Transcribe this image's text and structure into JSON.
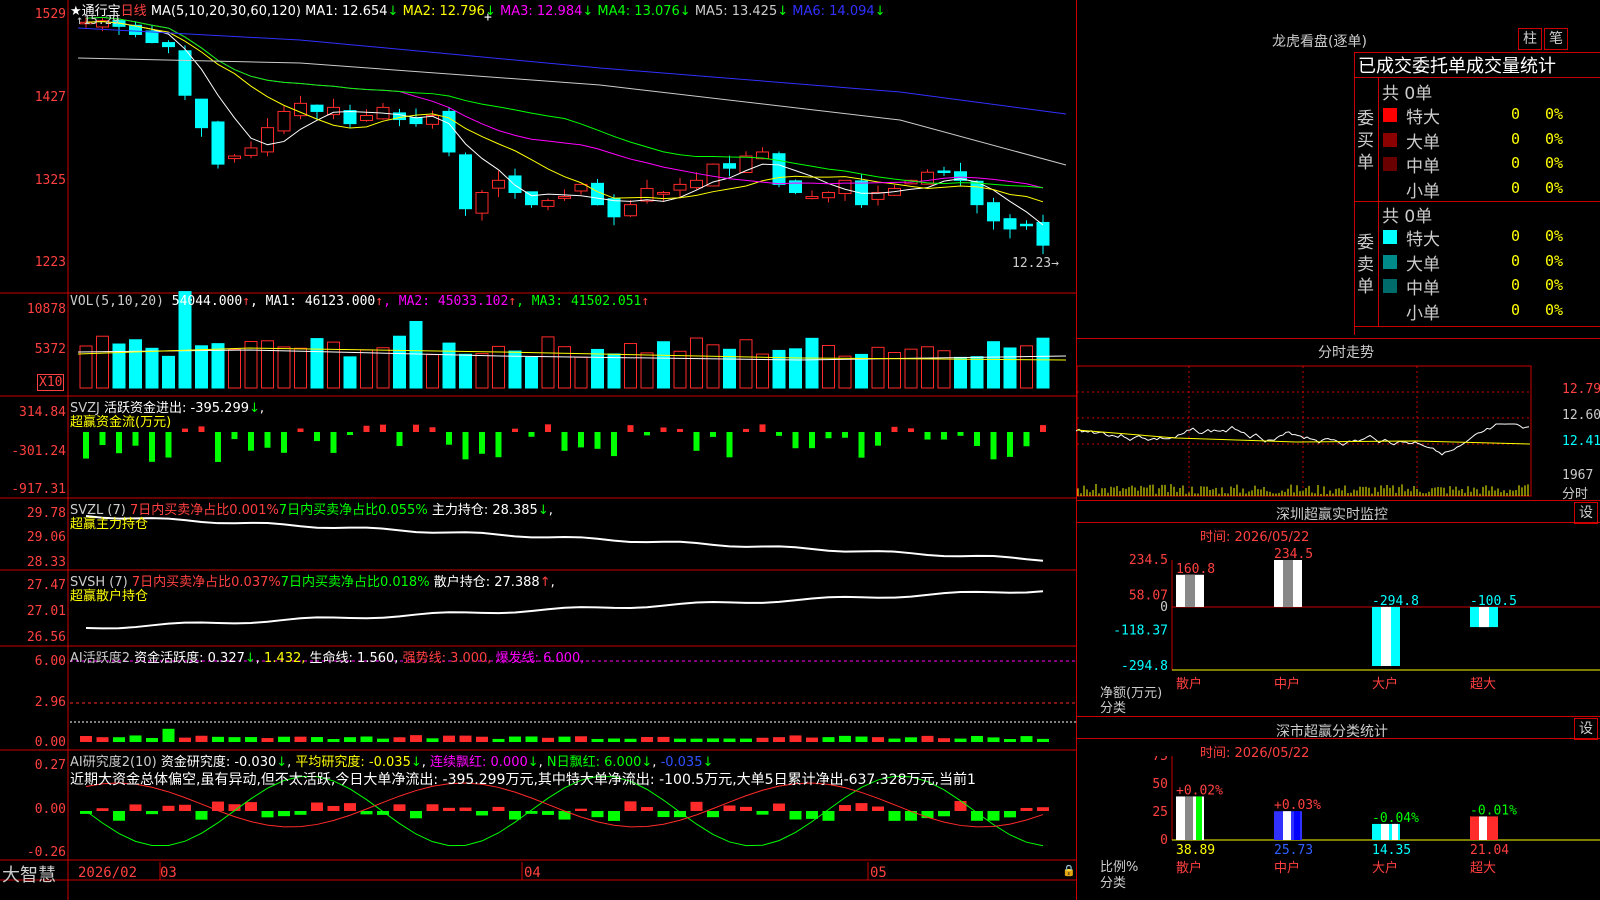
{
  "main": {
    "stock_name": "通行宝",
    "period": "日线",
    "high_label": "15.29",
    "last_label": "12.23",
    "ma_title": "MA(5,10,20,30,60,120)",
    "ma": [
      {
        "name": "MA1",
        "value": "12.654",
        "color": "#ffffff"
      },
      {
        "name": "MA2",
        "value": "12.796",
        "color": "#ffff00"
      },
      {
        "name": "MA3",
        "value": "12.984",
        "color": "#ff00ff"
      },
      {
        "name": "MA4",
        "value": "13.076",
        "color": "#00ff00"
      },
      {
        "name": "MA5",
        "value": "13.425",
        "color": "#cccccc"
      },
      {
        "name": "MA6",
        "value": "14.094",
        "color": "#3030ff"
      }
    ],
    "y_ticks": [
      "1529",
      "1427",
      "1325",
      "1223"
    ],
    "arrow_down": "↓"
  },
  "vol": {
    "title": "VOL(5,10,20)",
    "value": "54044.000",
    "ma": [
      {
        "name": "MA1",
        "value": "46123.000",
        "color": "#ffffff"
      },
      {
        "name": "MA2",
        "value": "45033.102",
        "color": "#ff00ff"
      },
      {
        "name": "MA3",
        "value": "41502.051",
        "color": "#00ff00"
      }
    ],
    "y_ticks": [
      "10878",
      "5372"
    ],
    "unit": "X10",
    "arrow_up": "↑"
  },
  "svzj": {
    "title": "SVZJ",
    "text": "活跃资金进出: -395.299",
    "sub": "超赢资金流(万元)",
    "y_ticks": [
      "314.84",
      "-301.24",
      "-917.31"
    ]
  },
  "svzl": {
    "title": "SVZL (7)",
    "t1": "7日内买卖净占比0.001%",
    "t2": "7日内买卖净占比0.055%",
    "t3": "主力持仓: 28.385",
    "sub": "超赢主力持仓",
    "y_ticks": [
      "29.78",
      "29.06",
      "28.33"
    ]
  },
  "svsh": {
    "title": "SVSH (7)",
    "t1": "7日内买卖净占比0.037%",
    "t2": "7日内买卖净占比0.018%",
    "t3": "散户持仓: 27.388",
    "sub": "超赢散户持仓",
    "y_ticks": [
      "27.47",
      "27.01",
      "26.56"
    ]
  },
  "ai1": {
    "title": "AI活跃度2",
    "t1": "资金活跃度: 0.327",
    "t2": "1.432,",
    "t3": "生命线: 1.560,",
    "t4": "强势线: 3.000,",
    "t5": "爆发线: 6.000,",
    "y_ticks": [
      "6.00",
      "2.96",
      "0.00"
    ]
  },
  "ai2": {
    "title": "AI研究度2(10)",
    "t1": "资金研究度: -0.030",
    "t2": "平均研究度: -0.035",
    "t3": "连续飘红: 0.000",
    "t4": "N日飘红: 6.000",
    "t5": "-0.035",
    "note": "近期大资金总体偏空,虽有异动,但不太活跃,今日大单净流出: -395.299万元,其中特大单净流出: -100.5万元,大单5日累计净出-637.328万元,当前1",
    "y_ticks": [
      "0.27",
      "0.00",
      "-0.26"
    ]
  },
  "bottom": {
    "brand": "大智慧",
    "dates": [
      "2026/02",
      "03",
      "04",
      "05"
    ]
  },
  "right": {
    "lhkp_title": "龙虎看盘(逐单)",
    "btn_zhu": "柱",
    "btn_bi": "笔",
    "stats_title": "已成交委托单成交量统计",
    "buy": {
      "side": "委买单",
      "total": "共 0单",
      "rows": [
        {
          "label": "特大",
          "count": "0",
          "pct": "0%",
          "color": "#ff0000"
        },
        {
          "label": "大单",
          "count": "0",
          "pct": "0%",
          "color": "#8b0000"
        },
        {
          "label": "中单",
          "count": "0",
          "pct": "0%",
          "color": "#6b0000"
        },
        {
          "label": "小单",
          "count": "0",
          "pct": "0%",
          "color": "#000000"
        }
      ]
    },
    "sell": {
      "side": "委卖单",
      "total": "共 0单",
      "rows": [
        {
          "label": "特大",
          "count": "0",
          "pct": "0%",
          "color": "#00ffff"
        },
        {
          "label": "大单",
          "count": "0",
          "pct": "0%",
          "color": "#008b8b"
        },
        {
          "label": "中单",
          "count": "0",
          "pct": "0%",
          "color": "#006b6b"
        },
        {
          "label": "小单",
          "count": "0",
          "pct": "0%",
          "color": "#000000"
        }
      ]
    },
    "fs_title": "分时走势",
    "fs_prices": [
      "12.79",
      "12.60",
      "12.41"
    ],
    "fs_vol": "1967",
    "fs_unit": "分时",
    "sz_title": "深圳超赢实时监控",
    "sz_btn": "设",
    "sz_time": "时间: 2026/05/22",
    "sz_yticks": [
      "234.5",
      "58.07",
      "0",
      "-118.37",
      "-294.8"
    ],
    "sz_bars": [
      {
        "label": "散户",
        "value": "160.8",
        "num": 160.8
      },
      {
        "label": "中户",
        "value": "234.5",
        "num": 234.5
      },
      {
        "label": "大户",
        "value": "-294.8",
        "num": -294.8
      },
      {
        "label": "超大",
        "value": "-100.5",
        "num": -100.5
      }
    ],
    "sz_unit": "净额(万元)",
    "sz_cat": "分类",
    "fl_title": "深市超赢分类统计",
    "fl_btn": "设",
    "fl_time": "时间: 2026/05/22",
    "fl_yticks": [
      "75",
      "50",
      "25",
      "0"
    ],
    "fl_bars": [
      {
        "label": "散户",
        "value": "38.89",
        "delta": "+0.02%",
        "num": 38.89
      },
      {
        "label": "中户",
        "value": "25.73",
        "delta": "+0.03%",
        "num": 25.73
      },
      {
        "label": "大户",
        "value": "14.35",
        "delta": "-0.04%",
        "num": 14.35
      },
      {
        "label": "超大",
        "value": "21.04",
        "delta": "-0.01%",
        "num": 21.04
      }
    ],
    "fl_unit": "比例%",
    "fl_cat": "分类"
  }
}
